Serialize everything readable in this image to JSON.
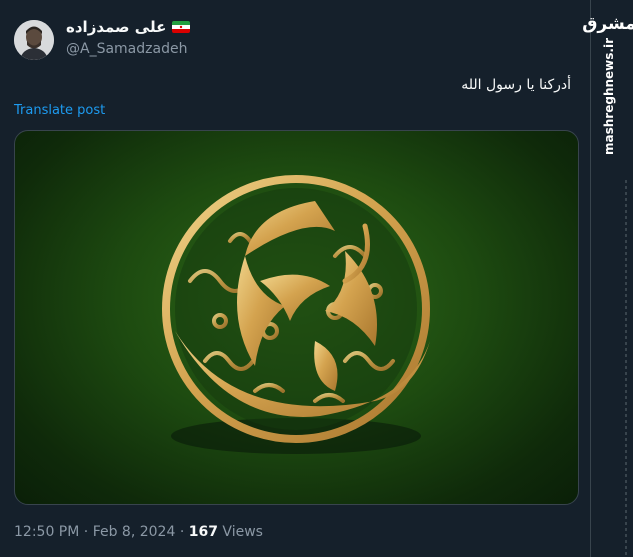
{
  "author": {
    "display_name": "علی صمدزاده",
    "handle": "@A_Samadzadeh"
  },
  "tweet": {
    "text": "أدركنا يا رسول الله",
    "translate_label": "Translate post"
  },
  "meta": {
    "time": "12:50 PM",
    "separator": "·",
    "date": "Feb 8, 2024",
    "views_count": "167",
    "views_label": "Views"
  },
  "watermark": {
    "logo": "مشرق",
    "url": "mashreghnews.ir"
  },
  "colors": {
    "background": "#15202b",
    "link": "#1d9bf0",
    "muted": "#8b98a5",
    "gold": "#d9b267"
  }
}
